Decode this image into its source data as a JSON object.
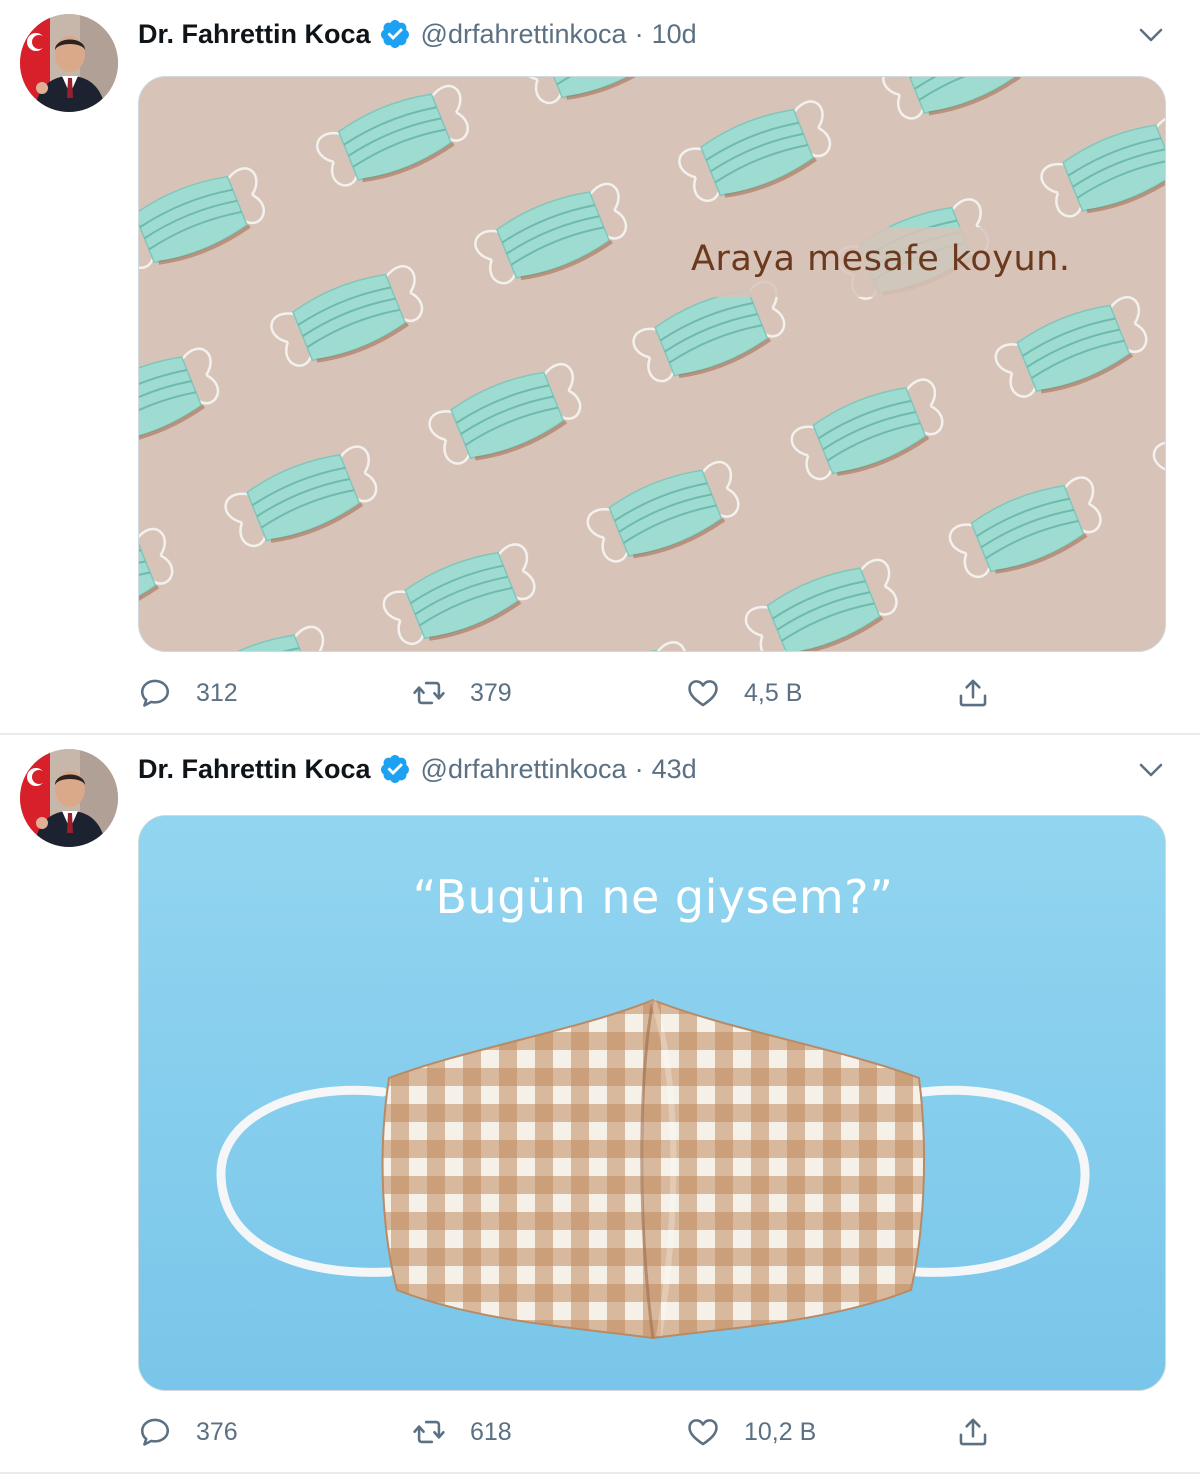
{
  "colors": {
    "name": "#0f1419",
    "secondary_text": "#5b7083",
    "verified_badge": "#1da1f2",
    "divider": "#e6ecf0",
    "image1_background": "#d8c3b8",
    "image1_mask": "#9edcd2",
    "image1_caption": "#6b3a1e",
    "image2_background": "#8fd3ef",
    "image2_caption": "#ffffff",
    "image2_mask_check": "#c08a5e"
  },
  "icons": {
    "verified": "verified-badge-icon",
    "more": "chevron-down-icon",
    "reply": "reply-icon",
    "retweet": "retweet-icon",
    "like": "heart-icon",
    "share": "share-icon"
  },
  "tweets": [
    {
      "author_name": "Dr. Fahrettin Koca",
      "handle": "@drfahrettinkoca",
      "separator": "·",
      "time": "10d",
      "image_text": "Araya mesafe koyun.",
      "replies": "312",
      "retweets": "379",
      "likes": "4,5 B"
    },
    {
      "author_name": "Dr. Fahrettin Koca",
      "handle": "@drfahrettinkoca",
      "separator": "·",
      "time": "43d",
      "image_text": "“Bugün ne giysem?”",
      "replies": "376",
      "retweets": "618",
      "likes": "10,2 B"
    }
  ]
}
